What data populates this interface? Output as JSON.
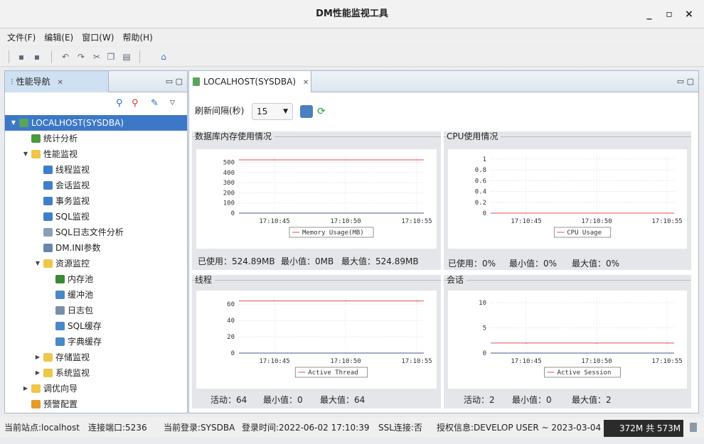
{
  "window": {
    "title": "DM性能监视工具",
    "minimize": "_",
    "maximize": "▫",
    "close": "×"
  },
  "menu": [
    "文件(F)",
    "编辑(E)",
    "窗口(W)",
    "帮助(H)"
  ],
  "nav_panel": {
    "tab_label": "性能导航",
    "tree": [
      {
        "label": "LOCALHOST(SYSDBA)",
        "level": 0,
        "expanded": true,
        "selected": true,
        "icon": "server-icon",
        "color": "#58a45c"
      },
      {
        "label": "统计分析",
        "level": 1,
        "icon": "stats-icon",
        "color": "#4a9a3c"
      },
      {
        "label": "性能监视",
        "level": 1,
        "expanded": true,
        "icon": "folder-icon",
        "color": "#f0c64a"
      },
      {
        "label": "线程监视",
        "level": 2,
        "icon": "gear-icon",
        "color": "#3f7fc8"
      },
      {
        "label": "会话监视",
        "level": 2,
        "icon": "session-icon",
        "color": "#3f7fc8"
      },
      {
        "label": "事务监视",
        "level": 2,
        "icon": "transaction-icon",
        "color": "#3f7fc8"
      },
      {
        "label": "SQL监视",
        "level": 2,
        "icon": "sql-icon",
        "color": "#3f7fc8"
      },
      {
        "label": "SQL日志文件分析",
        "level": 2,
        "icon": "log-file-icon",
        "color": "#8aa0b8"
      },
      {
        "label": "DM.INI参数",
        "level": 2,
        "icon": "ini-icon",
        "color": "#6a86a8"
      },
      {
        "label": "资源监控",
        "level": 2,
        "expanded": true,
        "icon": "folder-icon",
        "color": "#f0c64a"
      },
      {
        "label": "内存池",
        "level": 3,
        "icon": "memory-icon",
        "color": "#3a8a3a"
      },
      {
        "label": "缓冲池",
        "level": 3,
        "icon": "buffer-icon",
        "color": "#4a88c8"
      },
      {
        "label": "日志包",
        "level": 3,
        "icon": "log-package-icon",
        "color": "#7a90a8"
      },
      {
        "label": "SQL缓存",
        "level": 3,
        "icon": "sql-cache-icon",
        "color": "#4a88c8"
      },
      {
        "label": "字典缓存",
        "level": 3,
        "icon": "dictionary-icon",
        "color": "#4a88c8"
      },
      {
        "label": "存储监视",
        "level": 2,
        "expanded": false,
        "icon": "folder-icon",
        "color": "#f0c64a"
      },
      {
        "label": "系统监视",
        "level": 2,
        "expanded": false,
        "icon": "folder-icon",
        "color": "#f0c64a"
      },
      {
        "label": "调优向导",
        "level": 1,
        "expanded": false,
        "icon": "folder-icon",
        "color": "#f0c64a"
      },
      {
        "label": "预警配置",
        "level": 1,
        "icon": "alert-config-icon",
        "color": "#e59a2a"
      }
    ]
  },
  "editor": {
    "tab_label": "LOCALHOST(SYSDBA)",
    "refresh_label": "刷新间隔(秒)",
    "refresh_value": "15",
    "panels": {
      "memory": {
        "title": "数据库内存使用情况",
        "used_label": "已使用：",
        "used": "524.89MB",
        "min_label": "最小值：",
        "min": "0MB",
        "max_label": "最大值：",
        "max": "524.89MB"
      },
      "cpu": {
        "title": "CPU使用情况",
        "used_label": "已使用：",
        "used": "0%",
        "min_label": "最小值：",
        "min": "0%",
        "max_label": "最大值：",
        "max": "0%"
      },
      "threads": {
        "title": "线程",
        "active_label": "活动：",
        "active": "64",
        "min_label": "最小值：",
        "min": "0",
        "max_label": "最大值：",
        "max": "64"
      },
      "sessions": {
        "title": "会话",
        "active_label": "活动：",
        "active": "2",
        "min_label": "最小值：",
        "min": "0",
        "max_label": "最大值：",
        "max": "2"
      }
    }
  },
  "chart_data": [
    {
      "type": "line",
      "x": [
        "17:10:45",
        "17:10:50",
        "17:10:55"
      ],
      "yticks": [
        0,
        100,
        200,
        300,
        400,
        500
      ],
      "ylim": [
        0,
        560
      ],
      "series": [
        {
          "name": "Memory Usage(MB)",
          "values": [
            524.89,
            524.89,
            524.89
          ],
          "color": "#e05050"
        }
      ]
    },
    {
      "type": "line",
      "x": [
        "17:10:45",
        "17:10:50",
        "17:10:55"
      ],
      "yticks": [
        0,
        0.2,
        0.4,
        0.6,
        0.8,
        1
      ],
      "ylim": [
        0,
        1.05
      ],
      "series": [
        {
          "name": "CPU Usage",
          "values": [
            0,
            0,
            0
          ],
          "color": "#e05050"
        }
      ]
    },
    {
      "type": "line",
      "x": [
        "17:10:45",
        "17:10:50",
        "17:10:55"
      ],
      "yticks": [
        0,
        20,
        40,
        60
      ],
      "ylim": [
        0,
        68
      ],
      "series": [
        {
          "name": "Active Thread",
          "values": [
            64,
            64,
            64
          ],
          "color": "#e05050"
        }
      ]
    },
    {
      "type": "line",
      "x": [
        "17:10:45",
        "17:10:50",
        "17:10:55"
      ],
      "yticks": [
        0,
        5,
        10
      ],
      "ylim": [
        0,
        11
      ],
      "series": [
        {
          "name": "Active Session",
          "values": [
            2,
            2,
            2
          ],
          "color": "#e05050"
        }
      ]
    }
  ],
  "status": {
    "site": "当前站点:localhost",
    "port": "连接端口:5236",
    "login": "当前登录:SYSDBA",
    "login_time": "登录时间:2022-06-02 17:10:39",
    "ssl": "SSL连接:否",
    "license": "授权信息:DEVELOP USER ~ 2023-03-04",
    "memory": "372M 共 573M"
  }
}
